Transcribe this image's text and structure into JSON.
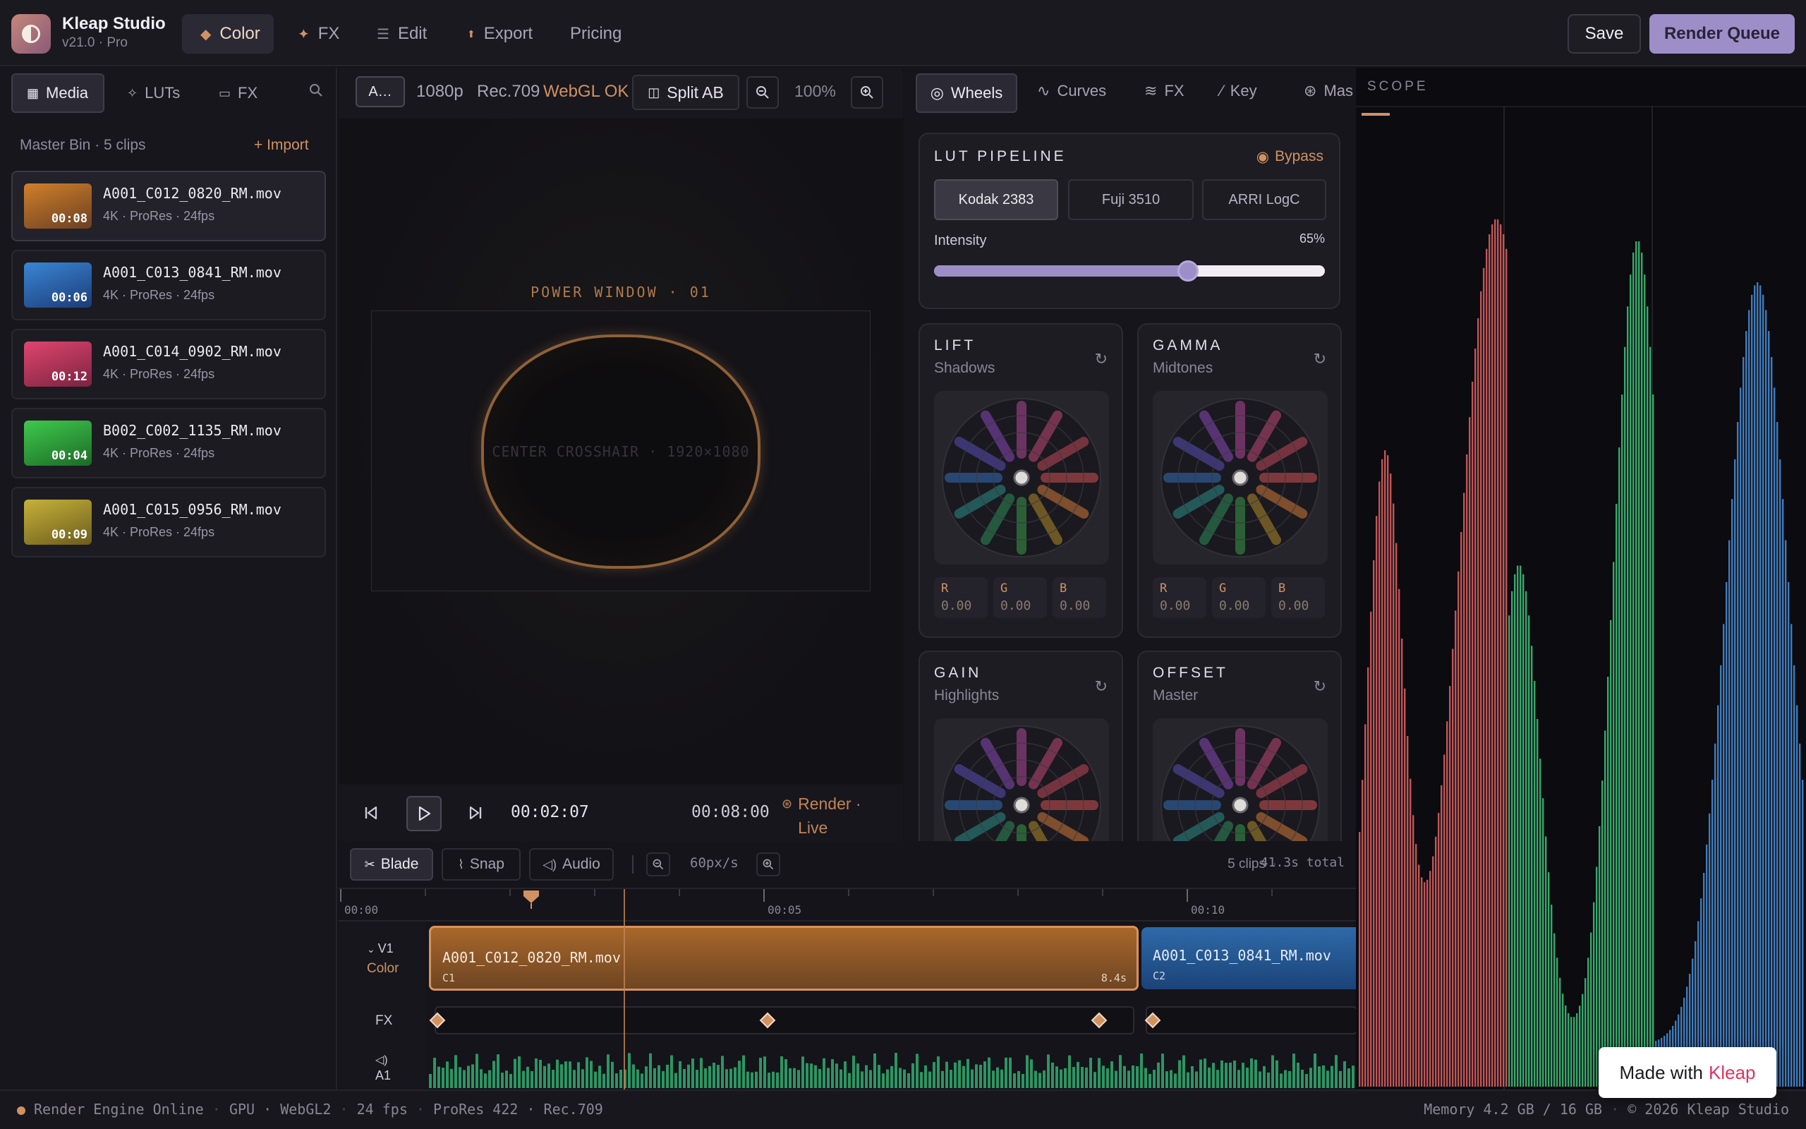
{
  "app": {
    "name": "Kleap Studio",
    "version": "v21.0 · Pro"
  },
  "nav": {
    "tabs": [
      {
        "label": "Color",
        "icon": "diamond-icon"
      },
      {
        "label": "FX",
        "icon": "sparkle-icon"
      },
      {
        "label": "Edit",
        "icon": "lines-icon"
      },
      {
        "label": "Export",
        "icon": "export-icon"
      },
      {
        "label": "Pricing",
        "icon": ""
      }
    ],
    "save_label": "Save",
    "render_queue_label": "Render Queue"
  },
  "left": {
    "tabs": [
      "Media",
      "LUTs",
      "FX"
    ],
    "bin_label": "Master Bin · 5 clips",
    "import_label": "+ Import",
    "clips": [
      {
        "name": "A001_C012_0820_RM.mov",
        "meta": "4K · ProRes  ·  24fps",
        "duration": "00:08",
        "color_a": "#d0802a",
        "color_b": "#6b3f22"
      },
      {
        "name": "A001_C013_0841_RM.mov",
        "meta": "4K · ProRes  ·  24fps",
        "duration": "00:06",
        "color_a": "#3a86d4",
        "color_b": "#1c3b78"
      },
      {
        "name": "A001_C014_0902_RM.mov",
        "meta": "4K · ProRes  ·  24fps",
        "duration": "00:12",
        "color_a": "#e0456e",
        "color_b": "#7a2340"
      },
      {
        "name": "B002_C002_1135_RM.mov",
        "meta": "4K · ProRes  ·  24fps",
        "duration": "00:04",
        "color_a": "#3fc94d",
        "color_b": "#1c6a26"
      },
      {
        "name": "A001_C015_0956_RM.mov",
        "meta": "4K · ProRes  ·  24fps",
        "duration": "00:09",
        "color_a": "#c6b23a",
        "color_b": "#6b5c1c"
      }
    ]
  },
  "viewer": {
    "clip_short": "A…",
    "resolution": "1080p",
    "colorspace": "Rec.709",
    "webgl": "WebGL OK",
    "split_label": "Split AB",
    "zoom": "100%",
    "power_window_label": "POWER WINDOW · 01",
    "crosshair_label": "CENTER CROSSHAIR · 1920×1080",
    "current_time": "00:02:07",
    "total_time": "00:08:00",
    "render_status": "Render · Live"
  },
  "grading": {
    "tabs": [
      "Wheels",
      "Curves",
      "FX",
      "Key",
      "Mas"
    ],
    "lut": {
      "title": "LUT PIPELINE",
      "bypass": "Bypass",
      "options": [
        "Kodak 2383",
        "Fuji 3510",
        "ARRI LogC"
      ],
      "selected": "Kodak 2383",
      "intensity_label": "Intensity",
      "intensity_value": "65%",
      "intensity": 0.65
    },
    "wheels": [
      {
        "title": "LIFT",
        "sub": "Shadows",
        "r": "0.00",
        "g": "0.00",
        "b": "0.00"
      },
      {
        "title": "GAMMA",
        "sub": "Midtones",
        "r": "0.00",
        "g": "0.00",
        "b": "0.00"
      },
      {
        "title": "GAIN",
        "sub": "Highlights"
      },
      {
        "title": "OFFSET",
        "sub": "Master"
      }
    ],
    "rgb_labels": [
      "R",
      "G",
      "B"
    ]
  },
  "scope": {
    "title": "SCOPE"
  },
  "timeline": {
    "tools": [
      "Blade",
      "Snap",
      "Audio"
    ],
    "zoom_label": "60px/s",
    "clip_count": "5 clips",
    "total": "41.3s total",
    "ruler": [
      "00:00",
      "00:05",
      "00:10"
    ],
    "tracks": {
      "v1": "V1",
      "v1_sub": "Color",
      "fx": "FX",
      "a1": "A1"
    },
    "clips": [
      {
        "name": "A001_C012_0820_RM.mov",
        "tag": "C1",
        "dur": "8.4s"
      },
      {
        "name": "A001_C013_0841_RM.mov",
        "tag": "C2",
        "dur": ""
      }
    ]
  },
  "status": {
    "left": "Render Engine Online",
    "gpu": "GPU · WebGL2",
    "fps": "24 fps",
    "codec": "ProRes 422 · Rec.709",
    "memory": "Memory 4.2 GB / 16 GB",
    "copyright": "© 2026 Kleap Studio"
  },
  "badge": {
    "prefix": "Made with",
    "brand": "Kleap"
  },
  "colors": {
    "accent": "#d19262",
    "render_queue": "#9e8ec8",
    "red": "#e06464",
    "green": "#3fc57a",
    "blue": "#4a8fd8"
  }
}
